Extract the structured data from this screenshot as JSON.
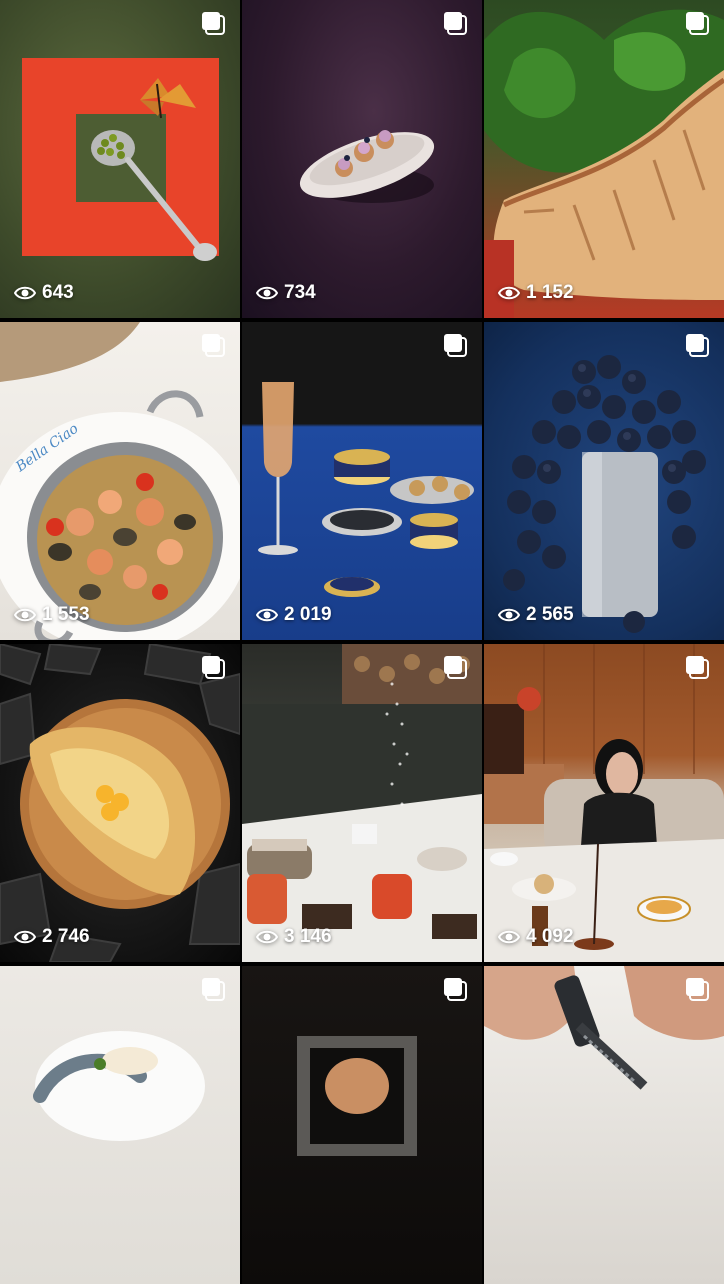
{
  "grid": {
    "tiles": [
      {
        "views": "643",
        "subject": "butterfly-spoon"
      },
      {
        "views": "734",
        "subject": "canape-dish"
      },
      {
        "views": "1 152",
        "subject": "duck-spinach"
      },
      {
        "views": "1 553",
        "subject": "seafood-pan"
      },
      {
        "views": "2 019",
        "subject": "caviar-champagne"
      },
      {
        "views": "2 565",
        "subject": "grapes-vase"
      },
      {
        "views": "2 746",
        "subject": "khachapuri"
      },
      {
        "views": "3 146",
        "subject": "restaurant-table"
      },
      {
        "views": "4 092",
        "subject": "woman-dining"
      },
      {
        "views": "",
        "subject": "fish-plate"
      },
      {
        "views": "",
        "subject": "dark-frame"
      },
      {
        "views": "",
        "subject": "hands-grater"
      }
    ]
  },
  "icons": {
    "multi": "multiple-posts-icon",
    "views": "eye-icon"
  },
  "colors": {
    "view_text": "#ffffff",
    "background": "#000000"
  }
}
